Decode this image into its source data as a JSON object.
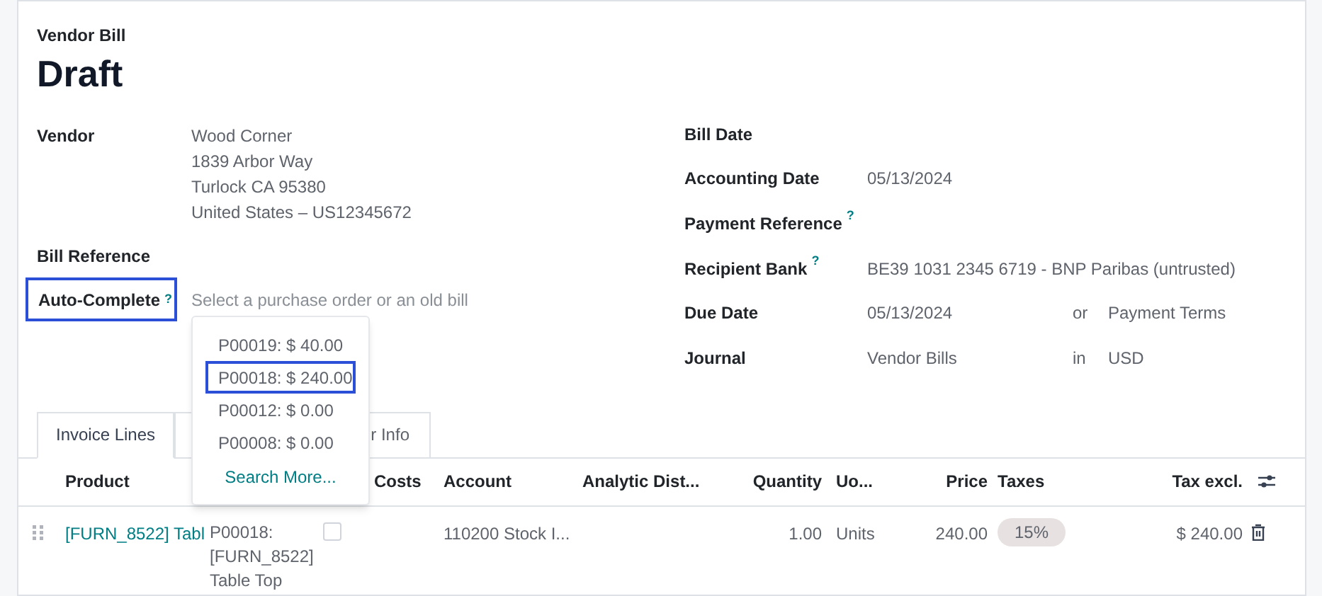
{
  "header": {
    "type_label": "Vendor Bill",
    "status": "Draft"
  },
  "left_fields": [
    {
      "kind": "address",
      "label": "Vendor",
      "lines": [
        "Wood Corner",
        "1839 Arbor Way",
        "Turlock CA 95380",
        "United States – US12345672"
      ]
    },
    {
      "kind": "empty",
      "label": "Bill Reference"
    },
    {
      "kind": "search",
      "label": "Auto-Complete",
      "help": "?",
      "highlighted": true,
      "placeholder": "Select a purchase order or an old bill"
    }
  ],
  "right_fields": [
    {
      "label": "Bill Date"
    },
    {
      "label": "Accounting Date",
      "value": "05/13/2024"
    },
    {
      "label": "Payment Reference",
      "help": "?"
    },
    {
      "label": "Recipient Bank",
      "help": "?",
      "value": "BE39 1031 2345 6719 - BNP Paribas (untrusted)"
    },
    {
      "label": "Due Date",
      "value": "05/13/2024",
      "connector": "or",
      "extra": "Payment Terms"
    },
    {
      "label": "Journal",
      "value": "Vendor Bills",
      "connector": "in",
      "extra": "USD"
    }
  ],
  "dropdown": {
    "options": [
      {
        "label": "P00019: $ 40.00",
        "highlighted": false
      },
      {
        "label": "P00018: $ 240.00",
        "highlighted": true
      },
      {
        "label": "P00012: $ 0.00",
        "highlighted": false
      },
      {
        "label": "P00008: $ 0.00",
        "highlighted": false
      }
    ],
    "search_more": "Search More..."
  },
  "tabs": [
    {
      "label": "Invoice Lines",
      "selected": true
    },
    {
      "label": "r Info",
      "selected": false
    }
  ],
  "table": {
    "headers": {
      "product": "Product",
      "column_3": "Costs",
      "account": "Account",
      "analytic": "Analytic Dist...",
      "quantity": "Quantity",
      "uom": "Uo...",
      "price": "Price",
      "taxes": "Taxes",
      "subtotal": "Tax excl."
    },
    "rows": [
      {
        "product": "[FURN_8522] Tabl",
        "column_2": "P00018: [FURN_8522] Table Top",
        "checked": false,
        "account": "110200 Stock I...",
        "quantity": "1.00",
        "uom": "Units",
        "price": "240.00",
        "taxes": [
          "15%"
        ],
        "subtotal": "$ 240.00"
      }
    ]
  }
}
